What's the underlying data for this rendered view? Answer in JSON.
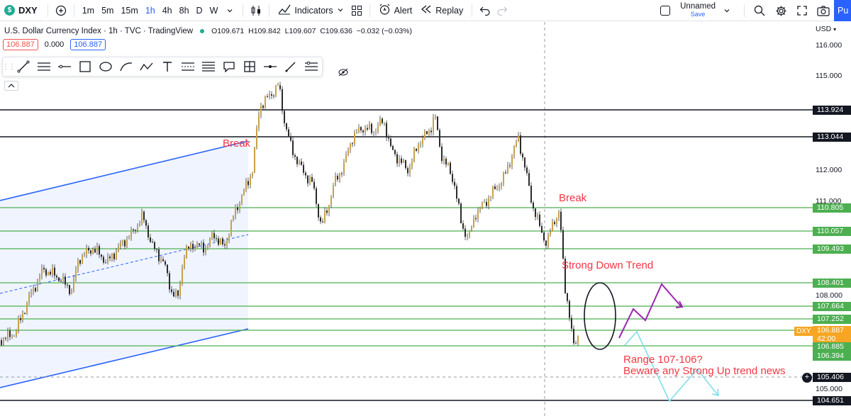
{
  "toolbar": {
    "symbol": "DXY",
    "symbol_logo": "$",
    "intervals": [
      "1m",
      "5m",
      "15m",
      "1h",
      "4h",
      "8h",
      "D",
      "W"
    ],
    "active_interval": "1h",
    "indicators_label": "Indicators",
    "alert_label": "Alert",
    "replay_label": "Replay",
    "layout_name": "Unnamed",
    "layout_status": "Save",
    "publish_label": "Pu",
    "accent_color": "#2962ff"
  },
  "legend": {
    "title": "U.S. Dollar Currency Index · 1h · TVC · TradingView",
    "open": "O109.671",
    "high": "H109.842",
    "low": "L109.607",
    "close": "C109.636",
    "change": "−0.032 (−0.03%)",
    "bid": "106.887",
    "spread": "0.000",
    "ask": "106.887"
  },
  "drawing_tools": [
    "trend-line-icon",
    "horizontal-rays-icon",
    "horizontal-line-icon",
    "rectangle-icon",
    "ellipse-icon",
    "path-icon",
    "polyline-icon",
    "text-icon",
    "parallel-channel-icon",
    "fib-icon",
    "callout-icon",
    "cross-icon",
    "price-line-icon",
    "brush-icon",
    "settings-lines-icon"
  ],
  "axis": {
    "currency": "USD",
    "ticks": [
      "116.000",
      "115.000",
      "112.000",
      "111.000",
      "108.000",
      "105.000"
    ],
    "level_labels": {
      "l113924": "113.924",
      "l113044": "113.044",
      "l110805": "110.805",
      "l110057": "110.057",
      "l109493": "109.493",
      "l108401": "108.401",
      "l107664": "107.664",
      "l107252": "107.252",
      "l106885": "106.885",
      "l106394": "106.394",
      "l105406": "105.406",
      "l104651": "104.651"
    },
    "current_price": "106.887",
    "countdown": "42:00",
    "symbol_tag": "DXY"
  },
  "annotations": {
    "break1": "Break",
    "break2": "Break",
    "strong_down": "Strong Down Trend",
    "range_line1": "Range 107-106?",
    "range_line2": "Beware any Strong Up trend news"
  },
  "colors": {
    "annotation": "#f23645",
    "green_level": "#4caf50",
    "channel": "#2962ff",
    "bull_path": "#9c27b0",
    "bear_path": "#80deea"
  }
}
